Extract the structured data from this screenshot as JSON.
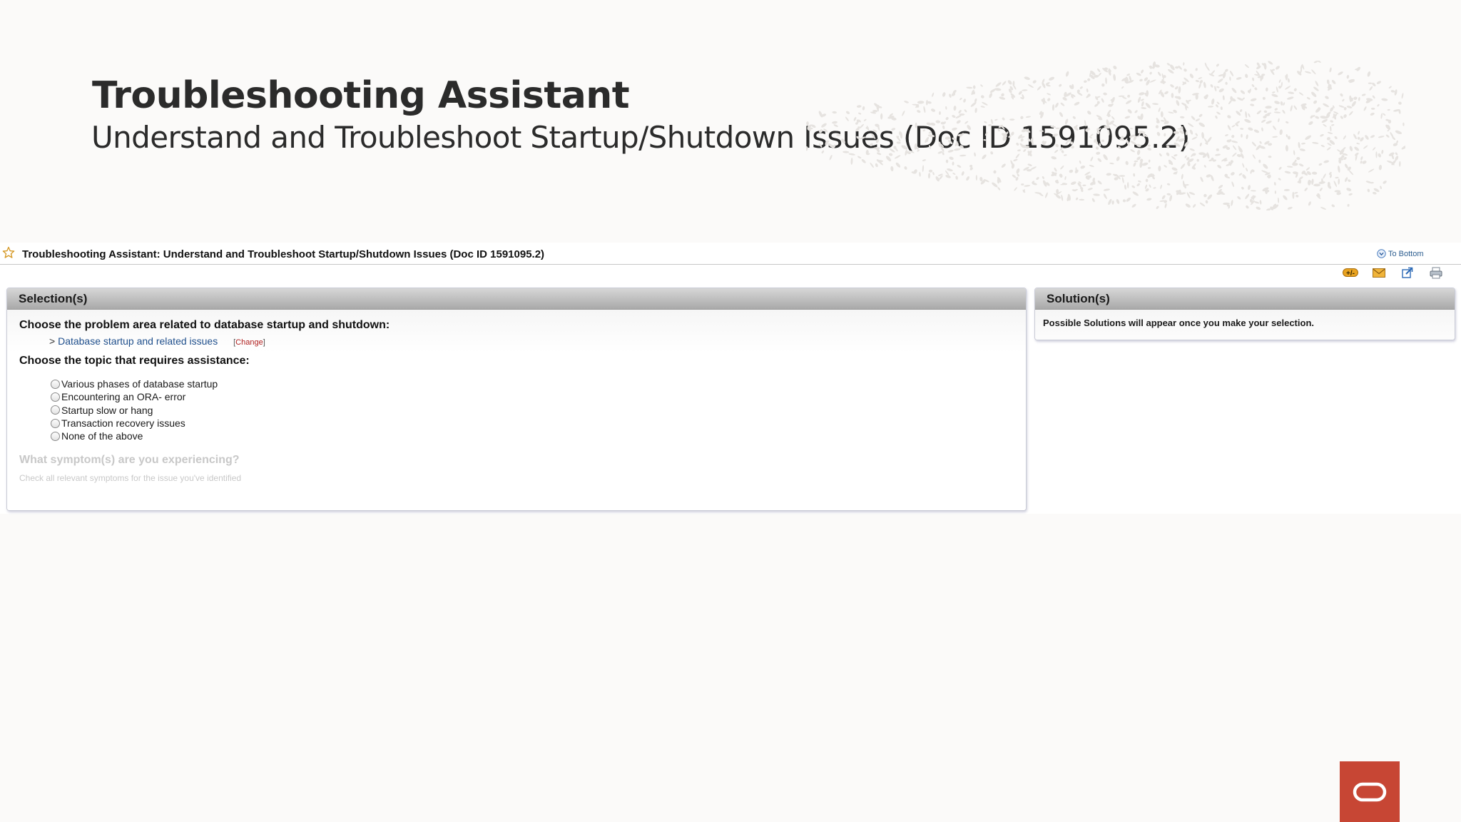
{
  "slide": {
    "title": "Troubleshooting Assistant",
    "subtitle": "Understand and Troubleshoot Startup/Shutdown Issues (Doc ID 1591095.2)"
  },
  "document": {
    "title": "Troubleshooting Assistant: Understand and Troubleshoot Startup/Shutdown Issues (Doc ID 1591095.2)",
    "to_bottom_label": "To Bottom",
    "toolbar_icons": [
      "add-to-favorites-icon",
      "email-icon",
      "open-new-window-icon",
      "print-icon"
    ]
  },
  "selections": {
    "header": "Selection(s)",
    "question1": "Choose the problem area related to database startup and shutdown:",
    "selected_prefix": ">",
    "selected_value": "Database startup and related issues",
    "change_open": "[",
    "change_label": "Change",
    "change_close": "]",
    "question2": "Choose the topic that requires assistance:",
    "options": [
      "Various phases of database startup",
      "Encountering an ORA- error",
      "Startup slow or hang",
      "Transaction recovery issues",
      "None of the above"
    ],
    "question3": "What symptom(s) are you experiencing?",
    "question3_hint": "Check all relevant symptoms for the issue you've identified"
  },
  "solutions": {
    "header": "Solution(s)",
    "text": "Possible Solutions will appear once you make your selection."
  },
  "colors": {
    "brand_red": "#c74634",
    "link_blue": "#1f4f8c",
    "change_red": "#b0201f"
  }
}
